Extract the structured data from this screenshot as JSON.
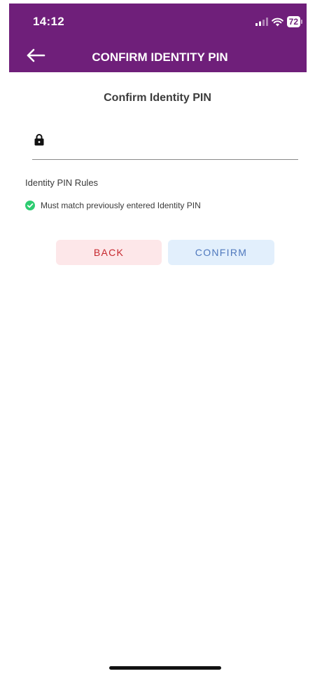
{
  "status_bar": {
    "time": "14:12",
    "battery": "72",
    "signal_icon": "cellular-signal-icon",
    "wifi_icon": "wifi-icon"
  },
  "header": {
    "title": "CONFIRM IDENTITY PIN",
    "back_icon": "arrow-left-icon",
    "background_color": "#6f1f7a"
  },
  "form": {
    "title": "Confirm Identity PIN",
    "pin_value": "",
    "pin_placeholder": "",
    "lock_icon": "lock-icon"
  },
  "rules": {
    "heading": "Identity PIN Rules",
    "items": [
      {
        "text": "Must match previously entered Identity PIN",
        "status": "satisfied",
        "icon": "check-circle-icon",
        "color": "#2ecc71"
      }
    ]
  },
  "actions": {
    "back_label": "BACK",
    "confirm_label": "CONFIRM",
    "back_color": "#c6282e",
    "confirm_color": "#4f78bd"
  }
}
